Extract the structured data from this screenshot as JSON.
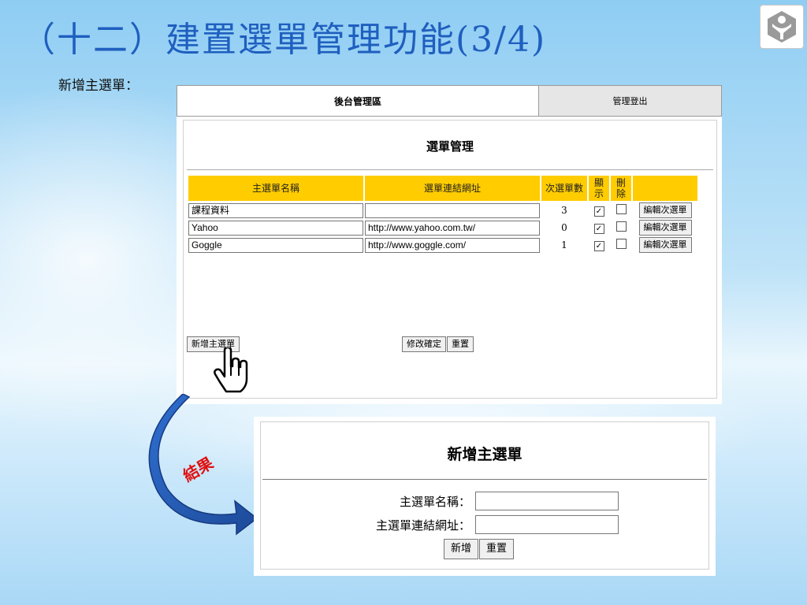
{
  "slide": {
    "title": "（十二）建置選單管理功能(3/4)",
    "subtitle": "新增主選單：",
    "logo_icon": "accessibility-logo-icon"
  },
  "admin": {
    "area_title": "後台管理區",
    "logout": "管理登出",
    "heading": "選單管理",
    "columns": {
      "name": "主選單名稱",
      "url": "選單連結網址",
      "sub_count": "次選單數",
      "show": "顯示",
      "delete": "刪除"
    },
    "rows": [
      {
        "name": "課程資料",
        "url": "",
        "count": "3",
        "show": true,
        "delete": false,
        "edit": "編輯次選單"
      },
      {
        "name": "Yahoo",
        "url": "http://www.yahoo.com.tw/",
        "count": "0",
        "show": true,
        "delete": false,
        "edit": "編輯次選單"
      },
      {
        "name": "Goggle",
        "url": "http://www.goggle.com/",
        "count": "1",
        "show": true,
        "delete": false,
        "edit": "編輯次選單"
      }
    ],
    "buttons": {
      "add_main": "新增主選單",
      "confirm": "修改確定",
      "reset": "重置"
    },
    "cursor_icon": "hand-pointer-icon"
  },
  "result": {
    "label": "結果",
    "arrow_color": "#2a5db0"
  },
  "form": {
    "heading": "新增主選單",
    "name_label": "主選單名稱：",
    "url_label": "主選單連結網址：",
    "name_value": "",
    "url_value": "",
    "submit": "新增",
    "reset": "重置"
  }
}
